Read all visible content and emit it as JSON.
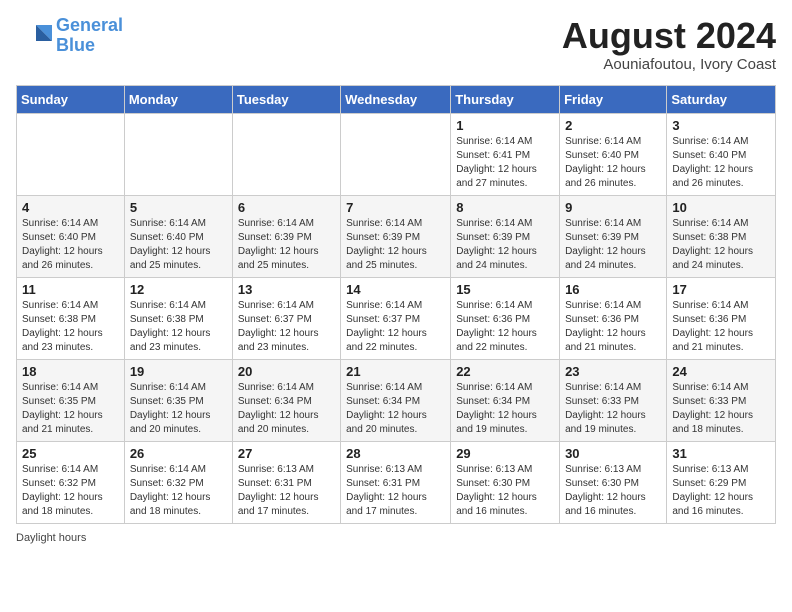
{
  "header": {
    "logo_line1": "General",
    "logo_line2": "Blue",
    "month_year": "August 2024",
    "location": "Aouniafoutou, Ivory Coast"
  },
  "days_of_week": [
    "Sunday",
    "Monday",
    "Tuesday",
    "Wednesday",
    "Thursday",
    "Friday",
    "Saturday"
  ],
  "weeks": [
    [
      {
        "day": "",
        "info": ""
      },
      {
        "day": "",
        "info": ""
      },
      {
        "day": "",
        "info": ""
      },
      {
        "day": "",
        "info": ""
      },
      {
        "day": "1",
        "info": "Sunrise: 6:14 AM\nSunset: 6:41 PM\nDaylight: 12 hours and 27 minutes."
      },
      {
        "day": "2",
        "info": "Sunrise: 6:14 AM\nSunset: 6:40 PM\nDaylight: 12 hours and 26 minutes."
      },
      {
        "day": "3",
        "info": "Sunrise: 6:14 AM\nSunset: 6:40 PM\nDaylight: 12 hours and 26 minutes."
      }
    ],
    [
      {
        "day": "4",
        "info": "Sunrise: 6:14 AM\nSunset: 6:40 PM\nDaylight: 12 hours and 26 minutes."
      },
      {
        "day": "5",
        "info": "Sunrise: 6:14 AM\nSunset: 6:40 PM\nDaylight: 12 hours and 25 minutes."
      },
      {
        "day": "6",
        "info": "Sunrise: 6:14 AM\nSunset: 6:39 PM\nDaylight: 12 hours and 25 minutes."
      },
      {
        "day": "7",
        "info": "Sunrise: 6:14 AM\nSunset: 6:39 PM\nDaylight: 12 hours and 25 minutes."
      },
      {
        "day": "8",
        "info": "Sunrise: 6:14 AM\nSunset: 6:39 PM\nDaylight: 12 hours and 24 minutes."
      },
      {
        "day": "9",
        "info": "Sunrise: 6:14 AM\nSunset: 6:39 PM\nDaylight: 12 hours and 24 minutes."
      },
      {
        "day": "10",
        "info": "Sunrise: 6:14 AM\nSunset: 6:38 PM\nDaylight: 12 hours and 24 minutes."
      }
    ],
    [
      {
        "day": "11",
        "info": "Sunrise: 6:14 AM\nSunset: 6:38 PM\nDaylight: 12 hours and 23 minutes."
      },
      {
        "day": "12",
        "info": "Sunrise: 6:14 AM\nSunset: 6:38 PM\nDaylight: 12 hours and 23 minutes."
      },
      {
        "day": "13",
        "info": "Sunrise: 6:14 AM\nSunset: 6:37 PM\nDaylight: 12 hours and 23 minutes."
      },
      {
        "day": "14",
        "info": "Sunrise: 6:14 AM\nSunset: 6:37 PM\nDaylight: 12 hours and 22 minutes."
      },
      {
        "day": "15",
        "info": "Sunrise: 6:14 AM\nSunset: 6:36 PM\nDaylight: 12 hours and 22 minutes."
      },
      {
        "day": "16",
        "info": "Sunrise: 6:14 AM\nSunset: 6:36 PM\nDaylight: 12 hours and 21 minutes."
      },
      {
        "day": "17",
        "info": "Sunrise: 6:14 AM\nSunset: 6:36 PM\nDaylight: 12 hours and 21 minutes."
      }
    ],
    [
      {
        "day": "18",
        "info": "Sunrise: 6:14 AM\nSunset: 6:35 PM\nDaylight: 12 hours and 21 minutes."
      },
      {
        "day": "19",
        "info": "Sunrise: 6:14 AM\nSunset: 6:35 PM\nDaylight: 12 hours and 20 minutes."
      },
      {
        "day": "20",
        "info": "Sunrise: 6:14 AM\nSunset: 6:34 PM\nDaylight: 12 hours and 20 minutes."
      },
      {
        "day": "21",
        "info": "Sunrise: 6:14 AM\nSunset: 6:34 PM\nDaylight: 12 hours and 20 minutes."
      },
      {
        "day": "22",
        "info": "Sunrise: 6:14 AM\nSunset: 6:34 PM\nDaylight: 12 hours and 19 minutes."
      },
      {
        "day": "23",
        "info": "Sunrise: 6:14 AM\nSunset: 6:33 PM\nDaylight: 12 hours and 19 minutes."
      },
      {
        "day": "24",
        "info": "Sunrise: 6:14 AM\nSunset: 6:33 PM\nDaylight: 12 hours and 18 minutes."
      }
    ],
    [
      {
        "day": "25",
        "info": "Sunrise: 6:14 AM\nSunset: 6:32 PM\nDaylight: 12 hours and 18 minutes."
      },
      {
        "day": "26",
        "info": "Sunrise: 6:14 AM\nSunset: 6:32 PM\nDaylight: 12 hours and 18 minutes."
      },
      {
        "day": "27",
        "info": "Sunrise: 6:13 AM\nSunset: 6:31 PM\nDaylight: 12 hours and 17 minutes."
      },
      {
        "day": "28",
        "info": "Sunrise: 6:13 AM\nSunset: 6:31 PM\nDaylight: 12 hours and 17 minutes."
      },
      {
        "day": "29",
        "info": "Sunrise: 6:13 AM\nSunset: 6:30 PM\nDaylight: 12 hours and 16 minutes."
      },
      {
        "day": "30",
        "info": "Sunrise: 6:13 AM\nSunset: 6:30 PM\nDaylight: 12 hours and 16 minutes."
      },
      {
        "day": "31",
        "info": "Sunrise: 6:13 AM\nSunset: 6:29 PM\nDaylight: 12 hours and 16 minutes."
      }
    ]
  ],
  "footer": {
    "text": "Daylight hours"
  }
}
